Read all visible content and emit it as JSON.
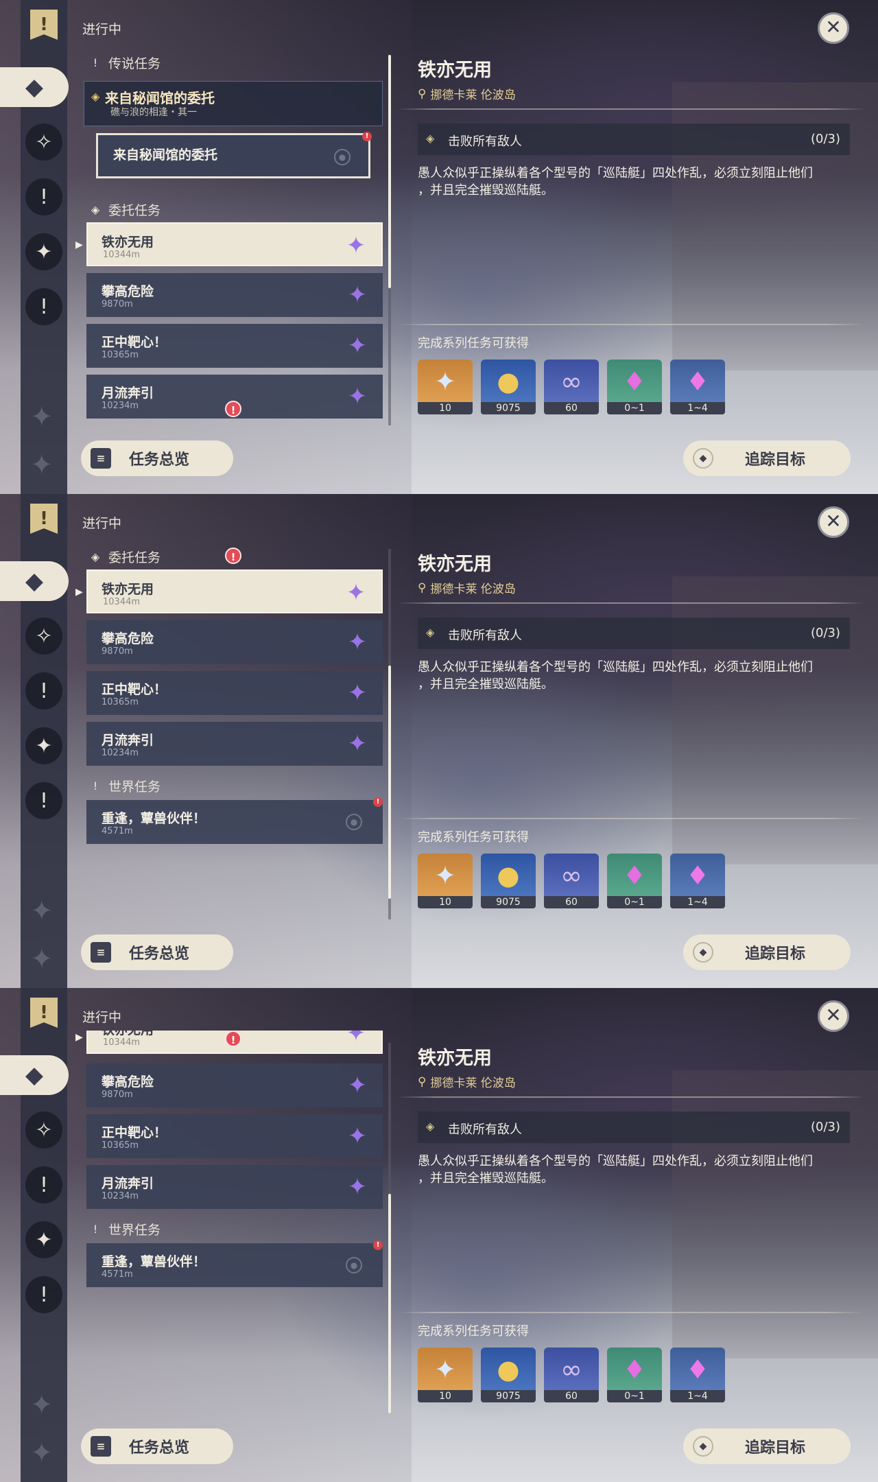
{
  "header": {
    "in_progress": "进行中"
  },
  "sections": {
    "legend": "传说任务",
    "commission": "委托任务",
    "world": "世界任务"
  },
  "legend_quest": {
    "title": "来自秘闻馆的委托",
    "subtitle": "礁与浪的相逢・其一"
  },
  "legend_step": {
    "title": "来自秘闻馆的委托"
  },
  "commissions": [
    {
      "title": "铁亦无用",
      "distance": "10344m"
    },
    {
      "title": "攀高危险",
      "distance": "9870m"
    },
    {
      "title": "正中靶心！",
      "distance": "10365m"
    },
    {
      "title": "月流奔引",
      "distance": "10234m"
    }
  ],
  "world_quest": {
    "title": "重逢，蕈兽伙伴！",
    "distance": "4571m"
  },
  "buttons": {
    "overview": "任务总览",
    "track": "追踪目标"
  },
  "detail": {
    "title": "铁亦无用",
    "location": "挪德卡莱 伦波岛",
    "objective": "击败所有敌人",
    "progress": "(0/3)",
    "description_line1": "愚人众似乎正操纵着各个型号的「巡陆艇」四处作乱，必须立刻阻止他们",
    "description_line2": "，并且完全摧毁巡陆艇。",
    "reward_label": "完成系列任务可获得"
  },
  "rewards": [
    {
      "icon": "primogem-icon",
      "count": "10"
    },
    {
      "icon": "mora-coin-icon",
      "count": "9075"
    },
    {
      "icon": "companionship-exp-icon",
      "count": "60"
    },
    {
      "icon": "crystal-chunk-icon",
      "count": "0~1"
    },
    {
      "icon": "crystal-cluster-icon",
      "count": "1~4"
    }
  ],
  "colors": {
    "panel": "#3a4156",
    "selected": "#ece6d6",
    "accent_gold": "#e4cf96",
    "alert_red": "#e34b56",
    "star_purple": "#9a73e6"
  }
}
